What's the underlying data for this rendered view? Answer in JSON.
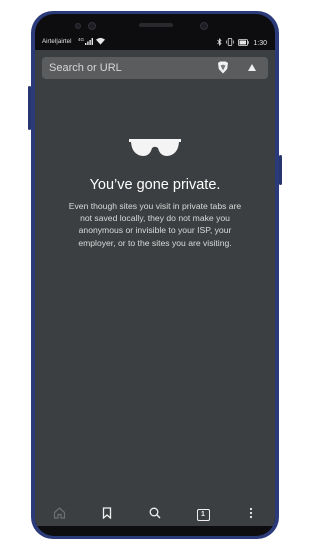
{
  "status_bar": {
    "carrier": "Airtel|airtel",
    "network": "4G",
    "bluetooth_icon": "bluetooth-icon",
    "vibrate_icon": "vibrate-icon",
    "battery_icon": "battery-icon",
    "time": "1:30"
  },
  "url_bar": {
    "placeholder": "Search or URL",
    "shield_icon": "brave-shield-icon",
    "menu_icon": "triangle-up-icon"
  },
  "private_page": {
    "icon": "sunglasses-icon",
    "title": "You’ve gone private.",
    "description": "Even though sites you visit in private tabs are not saved locally, they do not make you anonymous or invisible to your ISP, your employer, or to the sites you are visiting."
  },
  "toolbar": {
    "home_icon": "home-icon",
    "bookmark_icon": "bookmark-icon",
    "search_icon": "search-icon",
    "tab_count": "1",
    "more_icon": "more-vertical-icon"
  },
  "colors": {
    "page_background": "#3c3f41",
    "url_bar_background": "#5a5c5e",
    "phone_frame": "#2b3a78"
  }
}
